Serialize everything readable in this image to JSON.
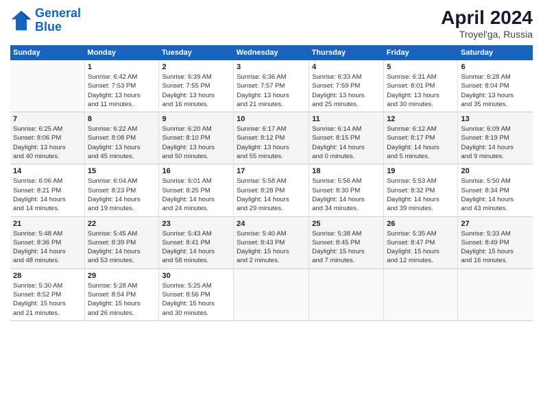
{
  "header": {
    "logo_line1": "General",
    "logo_line2": "Blue",
    "month_year": "April 2024",
    "location": "Troyel'ga, Russia"
  },
  "weekdays": [
    "Sunday",
    "Monday",
    "Tuesday",
    "Wednesday",
    "Thursday",
    "Friday",
    "Saturday"
  ],
  "weeks": [
    [
      {
        "day": "",
        "info": ""
      },
      {
        "day": "1",
        "info": "Sunrise: 6:42 AM\nSunset: 7:53 PM\nDaylight: 13 hours\nand 11 minutes."
      },
      {
        "day": "2",
        "info": "Sunrise: 6:39 AM\nSunset: 7:55 PM\nDaylight: 13 hours\nand 16 minutes."
      },
      {
        "day": "3",
        "info": "Sunrise: 6:36 AM\nSunset: 7:57 PM\nDaylight: 13 hours\nand 21 minutes."
      },
      {
        "day": "4",
        "info": "Sunrise: 6:33 AM\nSunset: 7:59 PM\nDaylight: 13 hours\nand 25 minutes."
      },
      {
        "day": "5",
        "info": "Sunrise: 6:31 AM\nSunset: 8:01 PM\nDaylight: 13 hours\nand 30 minutes."
      },
      {
        "day": "6",
        "info": "Sunrise: 6:28 AM\nSunset: 8:04 PM\nDaylight: 13 hours\nand 35 minutes."
      }
    ],
    [
      {
        "day": "7",
        "info": "Sunrise: 6:25 AM\nSunset: 8:06 PM\nDaylight: 13 hours\nand 40 minutes."
      },
      {
        "day": "8",
        "info": "Sunrise: 6:22 AM\nSunset: 8:08 PM\nDaylight: 13 hours\nand 45 minutes."
      },
      {
        "day": "9",
        "info": "Sunrise: 6:20 AM\nSunset: 8:10 PM\nDaylight: 13 hours\nand 50 minutes."
      },
      {
        "day": "10",
        "info": "Sunrise: 6:17 AM\nSunset: 8:12 PM\nDaylight: 13 hours\nand 55 minutes."
      },
      {
        "day": "11",
        "info": "Sunrise: 6:14 AM\nSunset: 8:15 PM\nDaylight: 14 hours\nand 0 minutes."
      },
      {
        "day": "12",
        "info": "Sunrise: 6:12 AM\nSunset: 8:17 PM\nDaylight: 14 hours\nand 5 minutes."
      },
      {
        "day": "13",
        "info": "Sunrise: 6:09 AM\nSunset: 8:19 PM\nDaylight: 14 hours\nand 9 minutes."
      }
    ],
    [
      {
        "day": "14",
        "info": "Sunrise: 6:06 AM\nSunset: 8:21 PM\nDaylight: 14 hours\nand 14 minutes."
      },
      {
        "day": "15",
        "info": "Sunrise: 6:04 AM\nSunset: 8:23 PM\nDaylight: 14 hours\nand 19 minutes."
      },
      {
        "day": "16",
        "info": "Sunrise: 6:01 AM\nSunset: 8:25 PM\nDaylight: 14 hours\nand 24 minutes."
      },
      {
        "day": "17",
        "info": "Sunrise: 5:58 AM\nSunset: 8:28 PM\nDaylight: 14 hours\nand 29 minutes."
      },
      {
        "day": "18",
        "info": "Sunrise: 5:56 AM\nSunset: 8:30 PM\nDaylight: 14 hours\nand 34 minutes."
      },
      {
        "day": "19",
        "info": "Sunrise: 5:53 AM\nSunset: 8:32 PM\nDaylight: 14 hours\nand 39 minutes."
      },
      {
        "day": "20",
        "info": "Sunrise: 5:50 AM\nSunset: 8:34 PM\nDaylight: 14 hours\nand 43 minutes."
      }
    ],
    [
      {
        "day": "21",
        "info": "Sunrise: 5:48 AM\nSunset: 8:36 PM\nDaylight: 14 hours\nand 48 minutes."
      },
      {
        "day": "22",
        "info": "Sunrise: 5:45 AM\nSunset: 8:39 PM\nDaylight: 14 hours\nand 53 minutes."
      },
      {
        "day": "23",
        "info": "Sunrise: 5:43 AM\nSunset: 8:41 PM\nDaylight: 14 hours\nand 58 minutes."
      },
      {
        "day": "24",
        "info": "Sunrise: 5:40 AM\nSunset: 8:43 PM\nDaylight: 15 hours\nand 2 minutes."
      },
      {
        "day": "25",
        "info": "Sunrise: 5:38 AM\nSunset: 8:45 PM\nDaylight: 15 hours\nand 7 minutes."
      },
      {
        "day": "26",
        "info": "Sunrise: 5:35 AM\nSunset: 8:47 PM\nDaylight: 15 hours\nand 12 minutes."
      },
      {
        "day": "27",
        "info": "Sunrise: 5:33 AM\nSunset: 8:49 PM\nDaylight: 15 hours\nand 16 minutes."
      }
    ],
    [
      {
        "day": "28",
        "info": "Sunrise: 5:30 AM\nSunset: 8:52 PM\nDaylight: 15 hours\nand 21 minutes."
      },
      {
        "day": "29",
        "info": "Sunrise: 5:28 AM\nSunset: 8:54 PM\nDaylight: 15 hours\nand 26 minutes."
      },
      {
        "day": "30",
        "info": "Sunrise: 5:25 AM\nSunset: 8:56 PM\nDaylight: 15 hours\nand 30 minutes."
      },
      {
        "day": "",
        "info": ""
      },
      {
        "day": "",
        "info": ""
      },
      {
        "day": "",
        "info": ""
      },
      {
        "day": "",
        "info": ""
      }
    ]
  ]
}
